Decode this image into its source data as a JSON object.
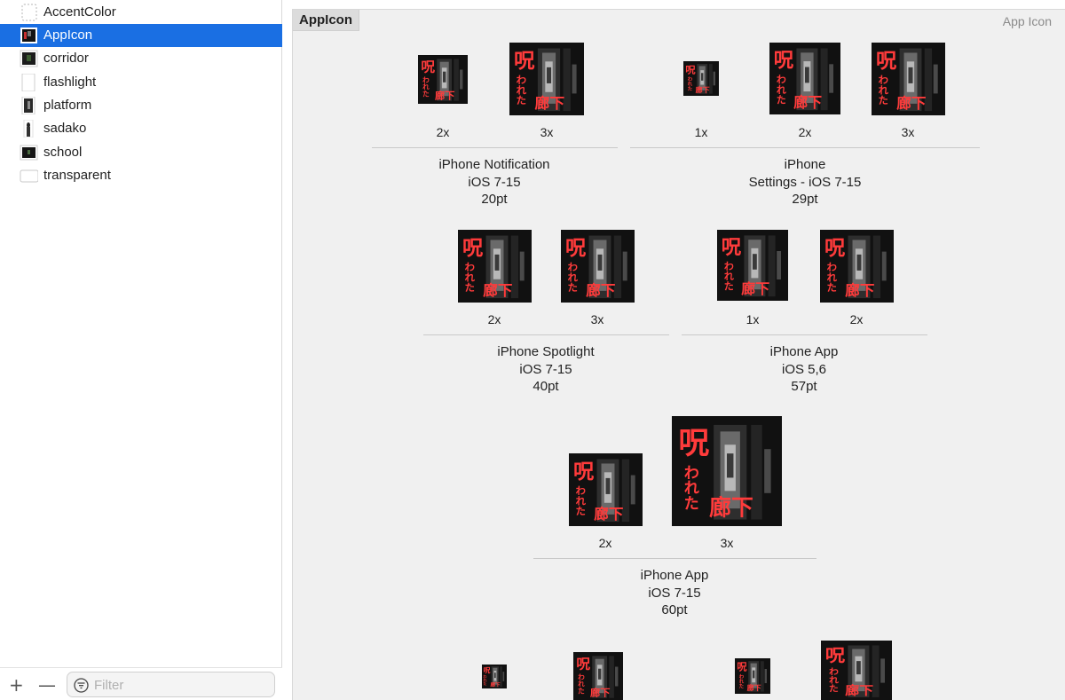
{
  "sidebar": {
    "items": [
      {
        "label": "AccentColor",
        "thumb": "color-placeholder"
      },
      {
        "label": "AppIcon",
        "thumb": "appicon"
      },
      {
        "label": "corridor",
        "thumb": "image"
      },
      {
        "label": "flashlight",
        "thumb": "image"
      },
      {
        "label": "platform",
        "thumb": "image"
      },
      {
        "label": "sadako",
        "thumb": "image"
      },
      {
        "label": "school",
        "thumb": "image"
      },
      {
        "label": "transparent",
        "thumb": "image"
      }
    ],
    "add_label": "+",
    "remove_label": "—",
    "filter_placeholder": "Filter"
  },
  "main": {
    "set_title": "AppIcon",
    "set_type": "App Icon",
    "groups": [
      {
        "line1": "iPhone Notification",
        "line2": "iOS 7-15",
        "line3": "20pt",
        "scales": [
          "2x",
          "3x"
        ]
      },
      {
        "line1": "iPhone",
        "line2": "Settings - iOS 7-15",
        "line3": "29pt",
        "scales": [
          "1x",
          "2x",
          "3x"
        ]
      },
      {
        "line1": "iPhone Spotlight",
        "line2": "iOS 7-15",
        "line3": "40pt",
        "scales": [
          "2x",
          "3x"
        ]
      },
      {
        "line1": "iPhone App",
        "line2": "iOS 5,6",
        "line3": "57pt",
        "scales": [
          "1x",
          "2x"
        ]
      },
      {
        "line1": "iPhone App",
        "line2": "iOS 7-15",
        "line3": "60pt",
        "scales": [
          "2x",
          "3x"
        ]
      }
    ],
    "icon_text": {
      "top": "呪",
      "middle": "われた",
      "bottom": "廊下"
    }
  },
  "colors": {
    "selection": "#1a6fe3",
    "icon_text": "#ff3b3b",
    "icon_bg": "#111111"
  }
}
